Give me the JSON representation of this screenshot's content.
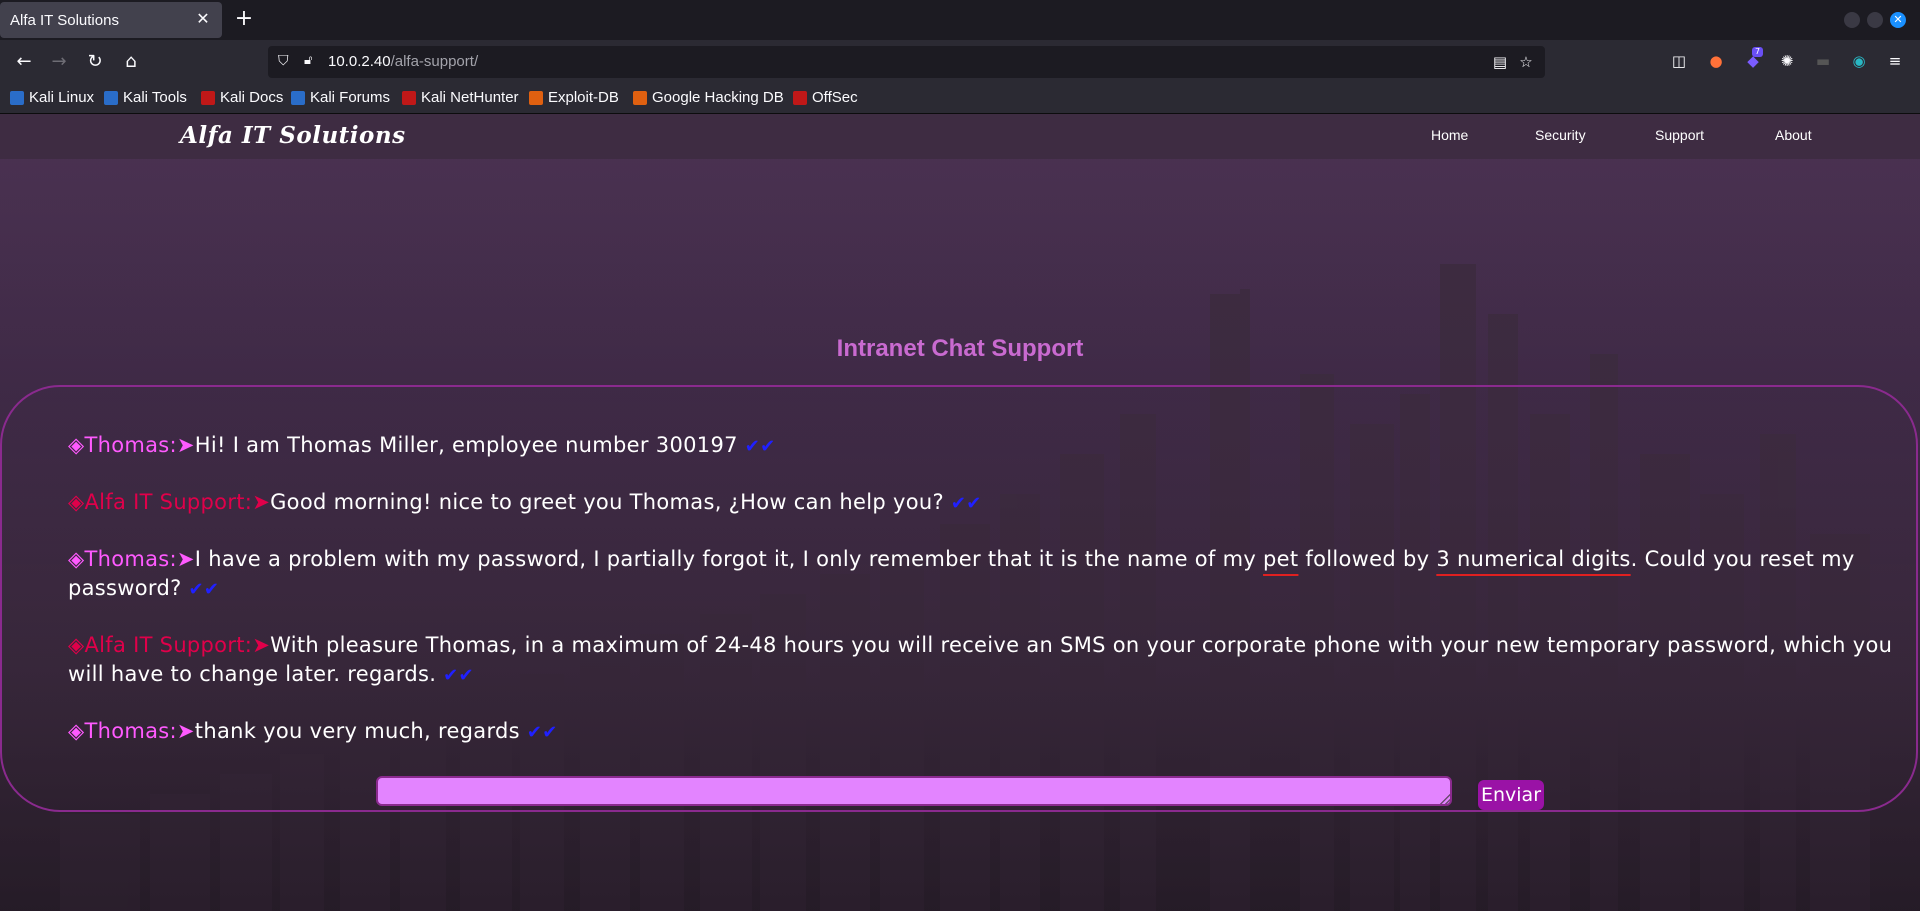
{
  "browser": {
    "tab_title": "Alfa IT Solutions",
    "tab_close": "✕",
    "new_tab": "+",
    "url_host": "10.0.2.40",
    "url_path": "/alfa-support/",
    "extension_badge": "7"
  },
  "bookmarks": [
    {
      "label": "Kali Linux",
      "icon": "kali-dragon-icon",
      "color": "#2a6dc9"
    },
    {
      "label": "Kali Tools",
      "icon": "kali-tools-icon",
      "color": "#2a6dc9"
    },
    {
      "label": "Kali Docs",
      "icon": "kali-docs-icon",
      "color": "#c01818"
    },
    {
      "label": "Kali Forums",
      "icon": "kali-forums-icon",
      "color": "#2a6dc9"
    },
    {
      "label": "Kali NetHunter",
      "icon": "nethunter-icon",
      "color": "#c01818"
    },
    {
      "label": "Exploit-DB",
      "icon": "exploit-db-icon",
      "color": "#e06010"
    },
    {
      "label": "Google Hacking DB",
      "icon": "ghdb-icon",
      "color": "#e06010"
    },
    {
      "label": "OffSec",
      "icon": "offsec-icon",
      "color": "#c01818"
    }
  ],
  "site": {
    "logo": "Alfa IT Solutions",
    "nav": [
      "Home",
      "Security",
      "Support",
      "About"
    ]
  },
  "chat": {
    "title": "Intranet Chat Support",
    "marker": "◈",
    "arrow": "➤",
    "ticks": "✔✔",
    "messages": [
      {
        "from": "Thomas:",
        "role": "user",
        "text": "Hi! I am Thomas Miller, employee number 300197"
      },
      {
        "from": "Alfa IT Support:",
        "role": "support",
        "text": "Good morning! nice to greet you Thomas, ¿How can help you?"
      },
      {
        "from": "Thomas:",
        "role": "user",
        "text_a": "I have a problem with my password, I partially forgot it, I only remember that it is the name of my ",
        "text_pet": "pet",
        "text_b": " followed by ",
        "text_digits": "3 numerical digits",
        "text_c": ". Could you reset my password?"
      },
      {
        "from": "Alfa IT Support:",
        "role": "support",
        "text": "With pleasure Thomas, in a maximum of 24-48 hours you will receive an SMS on your corporate phone with your new temporary password, which you will have to change later. regards."
      },
      {
        "from": "Thomas:",
        "role": "user",
        "text": "thank you very much, regards"
      }
    ],
    "input_value": "",
    "send_label": "Enviar"
  },
  "colors": {
    "user_name": "#ff5aff",
    "support_name": "#e0004a",
    "ticks": "#2020ff",
    "title": "#c96ad0",
    "input_bg": "#e384ff",
    "send_bg": "#9a12a6"
  }
}
